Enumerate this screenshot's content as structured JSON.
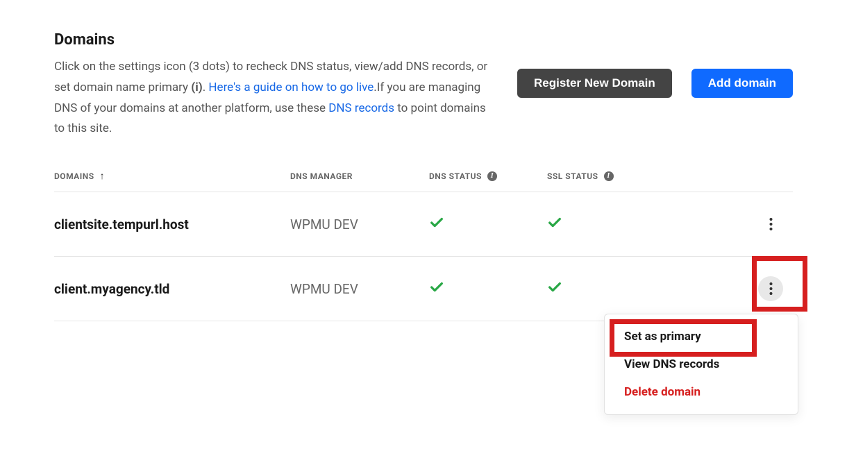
{
  "header": {
    "title": "Domains",
    "desc_part1": "Click on the settings icon (3 dots) to recheck DNS status, view/add DNS records, or set domain name primary ",
    "desc_info_bold": "(i)",
    "desc_part2": ". ",
    "desc_link1": "Here's a guide on how to go live",
    "desc_part3": ".If you are managing DNS of your domains at another platform, use these ",
    "desc_link2": "DNS records",
    "desc_part4": " to point domains to this site."
  },
  "buttons": {
    "register": "Register New Domain",
    "add": "Add domain"
  },
  "columns": {
    "domains": "DOMAINS",
    "manager": "DNS MANAGER",
    "dns": "DNS STATUS",
    "ssl": "SSL STATUS"
  },
  "rows": [
    {
      "domain": "clientsite.tempurl.host",
      "manager": "WPMU DEV",
      "dns_ok": true,
      "ssl_ok": true
    },
    {
      "domain": "client.myagency.tld",
      "manager": "WPMU DEV",
      "dns_ok": true,
      "ssl_ok": true
    }
  ],
  "menu": {
    "set_primary": "Set as primary",
    "view_dns": "View DNS records",
    "delete": "Delete domain"
  }
}
